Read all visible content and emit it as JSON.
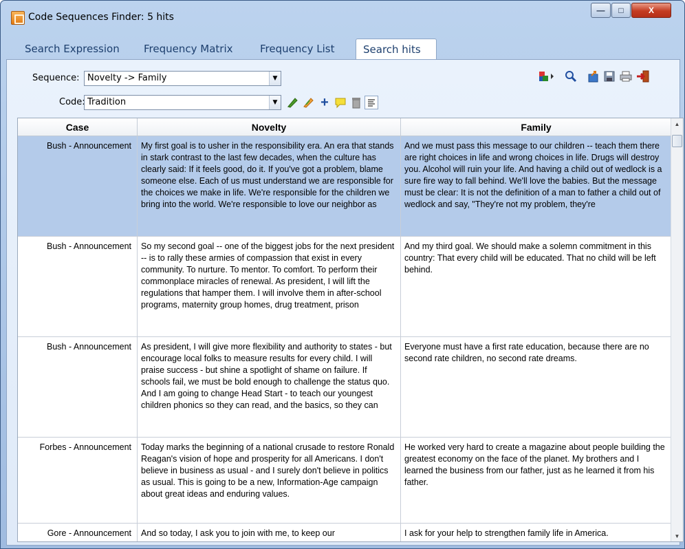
{
  "window": {
    "title": "Code Sequences Finder: 5 hits",
    "minimize_symbol": "—",
    "maximize_symbol": "□",
    "close_symbol": "X"
  },
  "tabs": [
    {
      "label": "Search Expression"
    },
    {
      "label": "Frequency Matrix"
    },
    {
      "label": "Frequency List"
    },
    {
      "label": "Search hits"
    }
  ],
  "controls": {
    "sequence_label": "Sequence:",
    "sequence_value": "Novelty -> Family",
    "code_label": "Code:",
    "code_value": "Tradition",
    "dropdown_arrow": "▼"
  },
  "icons": {
    "code_toolbar": [
      "highlighter-green-icon",
      "highlighter-multi-icon",
      "add-icon",
      "comment-icon",
      "delete-icon",
      "text-view-icon"
    ],
    "top_toolbar": [
      "group-arrow-icon",
      "search-icon",
      "export-icon",
      "save-icon",
      "print-icon",
      "exit-icon"
    ],
    "glyphs": {
      "add": "+",
      "scroll_up": "▲",
      "scroll_down": "▼"
    }
  },
  "table": {
    "columns": [
      "Case",
      "Novelty",
      "Family"
    ],
    "rows": [
      {
        "case": "Bush - Announcement",
        "novelty": "My first goal is to usher in the responsibility era. An era that stands in stark contrast to the last few decades, when the culture has clearly said: If it feels good, do it. If you've got a problem, blame someone else. Each of us must understand we are responsible for the choices we make in life. We're responsible for the children we bring into the world. We're responsible to love our neighbor as",
        "family": "And we must pass this message to our children -- teach them there are right choices in life and wrong choices in life. Drugs will destroy you. Alcohol will ruin your life. And having a child out of wedlock is a sure fire way to fall behind. We'll love the babies. But the message must be clear: It is not the definition of a man to father a child out of wedlock and say, \"They're not my problem, they're",
        "selected": true
      },
      {
        "case": "Bush - Announcement",
        "novelty": "So my second goal -- one of the biggest jobs for the next president -- is to rally these armies of compassion that exist in every community. To nurture. To mentor. To comfort. To perform their commonplace miracles of renewal.  As president, I will lift the regulations that hamper them. I will involve them in after-school programs, maternity group homes, drug treatment, prison",
        "family": "And my third goal. We should make a solemn commitment in this country: That every child will be educated. That no child will be left behind.",
        "selected": false
      },
      {
        "case": "Bush - Announcement",
        "novelty": "As president, I will give more flexibility and authority to states - but encourage local folks to measure results for every child. I will praise success - but shine a spotlight of shame on failure. If schools fail, we must be bold enough to challenge the status quo. And I am going to change Head Start - to teach our youngest children phonics so they can read, and the basics, so they can",
        "family": "Everyone must have a first rate education, because there are no second rate children, no second rate dreams.",
        "selected": false
      },
      {
        "case": "Forbes - Announcement",
        "novelty": "Today marks the beginning of a national crusade to restore Ronald Reagan's vision of hope and prosperity for all Americans.  I don't believe in business as usual - and I surely don't believe in politics as usual.  This is going to be a new, Information-Age campaign about great ideas and enduring values.",
        "family": "He worked very hard to create a magazine about people building the greatest economy on the face of the planet.  My brothers and I learned the business from our father, just as he learned it from his father.",
        "selected": false
      },
      {
        "case": "Gore - Announcement",
        "novelty": "And so today, I ask you to join with me, to keep our",
        "family": "I ask for your help to strengthen family life in America.",
        "selected": false
      }
    ]
  }
}
